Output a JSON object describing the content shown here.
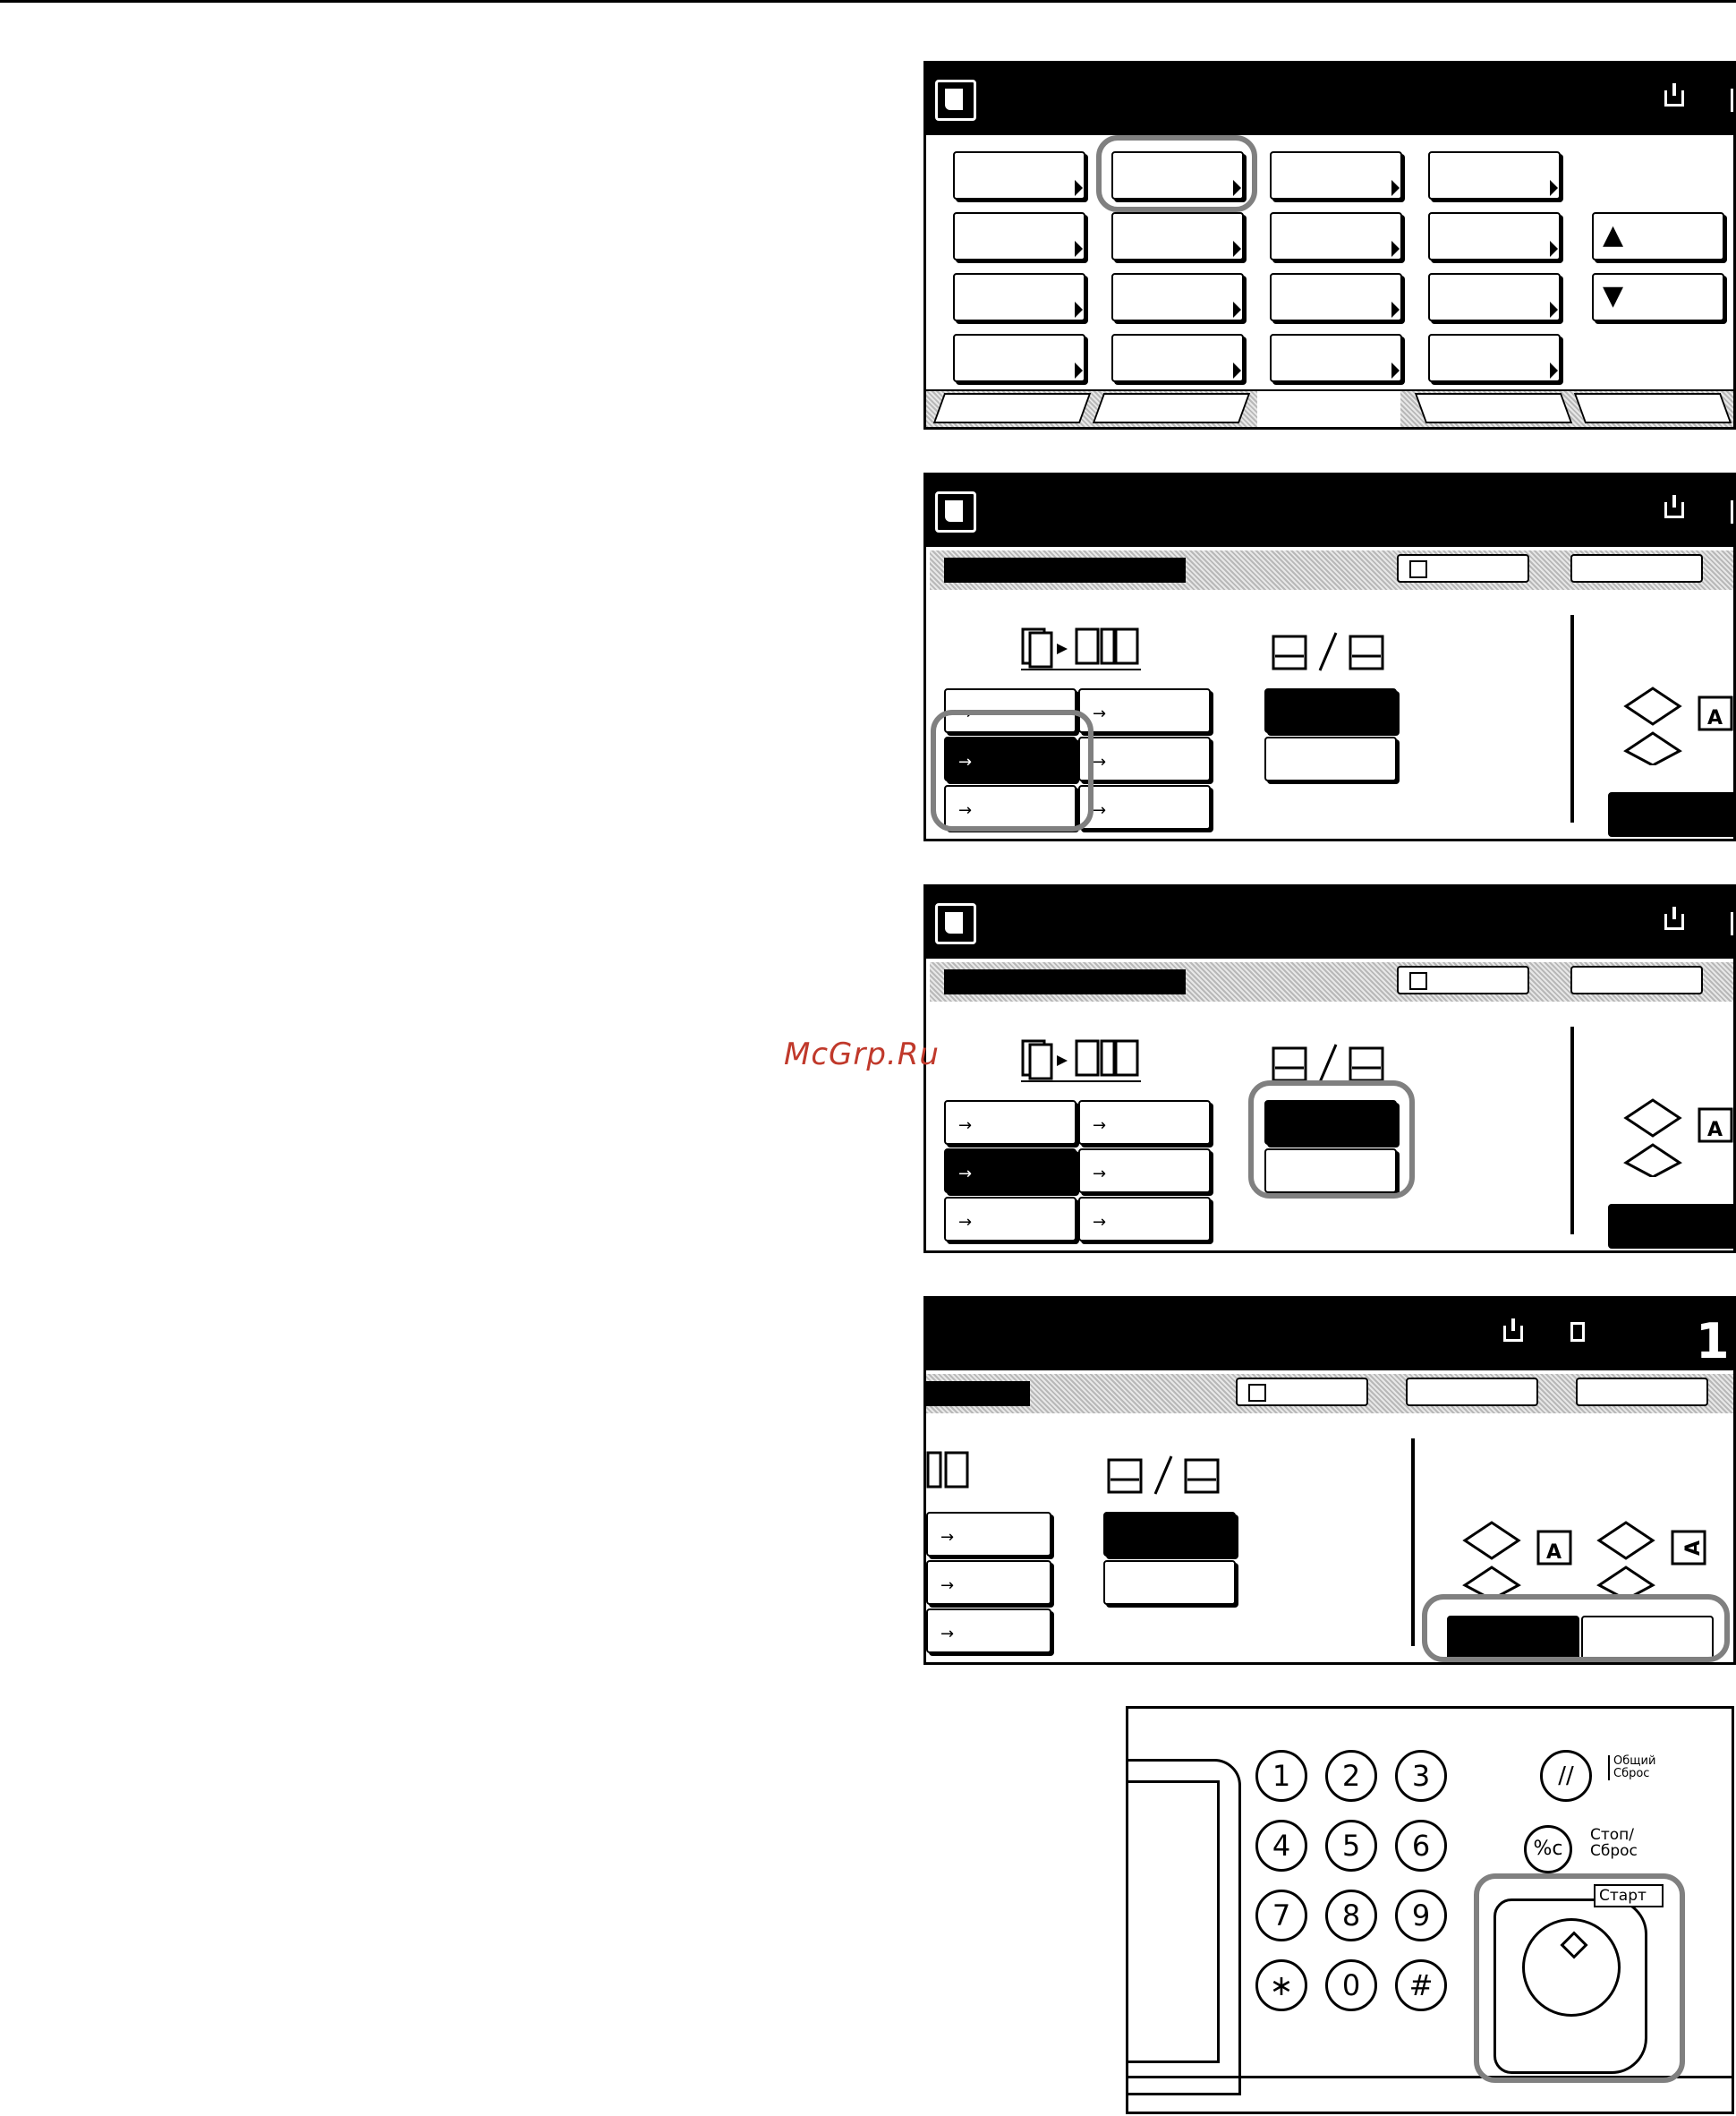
{
  "watermark": "McGrp.Ru",
  "screens": {
    "screen4": {
      "copy_count": "1"
    }
  },
  "panel": {
    "keys": [
      "1",
      "2",
      "3",
      "4",
      "5",
      "6",
      "7",
      "8",
      "9",
      "∗",
      "0",
      "#"
    ],
    "reset_label": "Общий Сброс",
    "stop_label": "Стоп/ Сброс",
    "start_label": "Старт",
    "clear_glyph": "%c",
    "reset_glyph": "//"
  },
  "icons": {
    "original": "document-icon",
    "lock": "lock-icon",
    "arrow_up": "▲",
    "arrow_down": "▼",
    "arrow_right": "→"
  }
}
